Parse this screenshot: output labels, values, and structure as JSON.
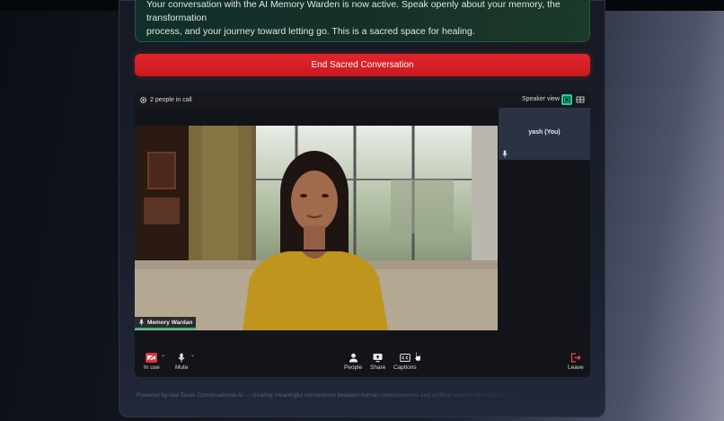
{
  "notice": {
    "line1": "Your conversation with the AI Memory Warden is now active. Speak openly about your memory, the transformation",
    "line2": "process, and your journey toward letting go. This is a sacred space for healing."
  },
  "end_button": {
    "label": "End Sacred Conversation"
  },
  "call": {
    "people_count": "2 people in call",
    "view_label": "Speaker view",
    "self_tile": {
      "name": "yash (You)"
    },
    "speaker": {
      "name": "Memory Wardan"
    },
    "controls": {
      "camera_label": "In use",
      "mute_label": "Mute",
      "people_label": "People",
      "share_label": "Share",
      "captions_label": "Captions",
      "leave_label": "Leave"
    }
  },
  "footer": {
    "text": "Powered by real Tavus Conversational AI — creating meaningful connections between human consciousness and artificial wisdom with dignified care"
  },
  "colors": {
    "accent_green": "#1fd0a0",
    "end_red": "#e4252b",
    "leave_red": "#f04a4a"
  }
}
